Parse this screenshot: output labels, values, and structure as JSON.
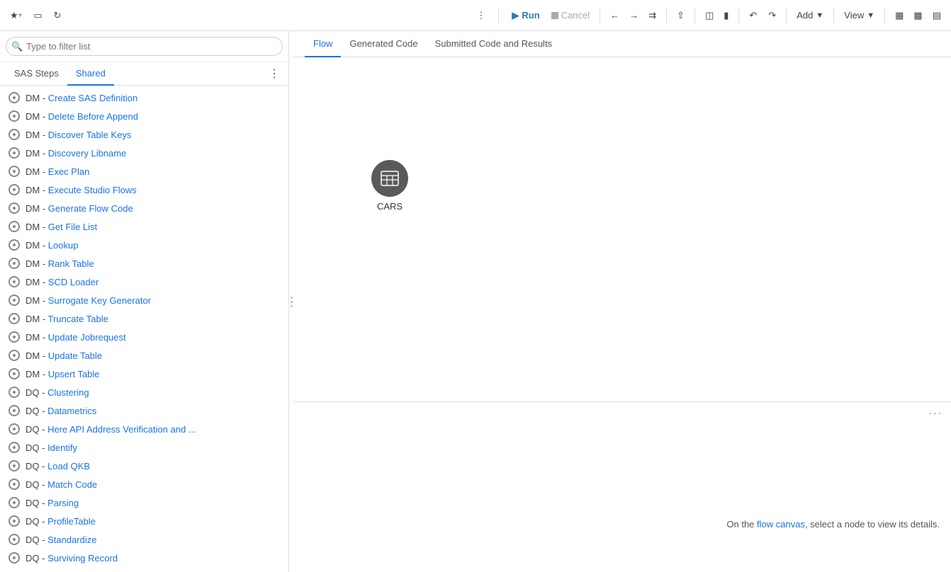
{
  "toolbar": {
    "run_label": "Run",
    "cancel_label": "Cancel",
    "add_label": "Add",
    "add_arrow": "▼",
    "view_label": "View",
    "view_arrow": "▼"
  },
  "filter": {
    "placeholder": "Type to filter list"
  },
  "panel_tabs": {
    "sas_steps": "SAS Steps",
    "shared": "Shared",
    "more_icon": "⋮"
  },
  "content_tabs": {
    "flow": "Flow",
    "generated_code": "Generated Code",
    "submitted_code": "Submitted Code and Results"
  },
  "steps": [
    {
      "label": "DM - Create SAS Definition"
    },
    {
      "label": "DM - Delete Before Append"
    },
    {
      "label": "DM - Discover Table Keys"
    },
    {
      "label": "DM - Discovery Libname"
    },
    {
      "label": "DM - Exec Plan"
    },
    {
      "label": "DM - Execute Studio Flows"
    },
    {
      "label": "DM - Generate Flow Code"
    },
    {
      "label": "DM - Get File List"
    },
    {
      "label": "DM - Lookup"
    },
    {
      "label": "DM - Rank Table"
    },
    {
      "label": "DM - SCD Loader"
    },
    {
      "label": "DM - Surrogate Key Generator"
    },
    {
      "label": "DM - Truncate Table"
    },
    {
      "label": "DM - Update Jobrequest"
    },
    {
      "label": "DM - Update Table"
    },
    {
      "label": "DM - Upsert Table"
    },
    {
      "label": "DQ - Clustering"
    },
    {
      "label": "DQ - Datametrics"
    },
    {
      "label": "DQ - Here API Address Verification and ..."
    },
    {
      "label": "DQ - Identify"
    },
    {
      "label": "DQ - Load QKB"
    },
    {
      "label": "DQ - Match Code"
    },
    {
      "label": "DQ - Parsing"
    },
    {
      "label": "DQ - ProfileTable"
    },
    {
      "label": "DQ - Standardize"
    },
    {
      "label": "DQ - Surviving Record"
    }
  ],
  "canvas": {
    "node_label": "CARS",
    "node_icon": "⊞",
    "details_hint_pre": "On the ",
    "details_hint_link": "flow canvas",
    "details_hint_post": ", select a node to view its details.",
    "dots_menu": "..."
  }
}
